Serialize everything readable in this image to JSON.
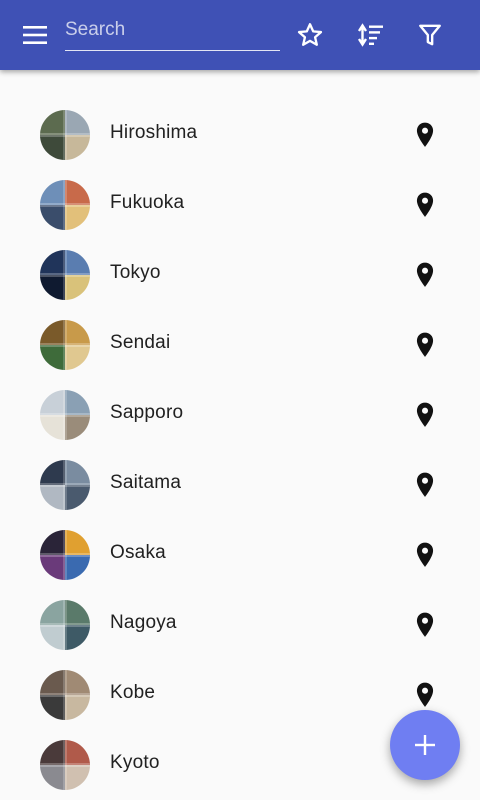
{
  "appbar": {
    "color": "#3f51b5",
    "menu_icon": "menu-icon",
    "search_placeholder": "Search",
    "search_value": "",
    "actions": [
      "star-icon",
      "sort-icon",
      "filter-icon"
    ]
  },
  "cities": [
    {
      "name": "Hiroshima"
    },
    {
      "name": "Fukuoka"
    },
    {
      "name": "Tokyo"
    },
    {
      "name": "Sendai"
    },
    {
      "name": "Sapporo"
    },
    {
      "name": "Saitama"
    },
    {
      "name": "Osaka"
    },
    {
      "name": "Nagoya"
    },
    {
      "name": "Kobe"
    },
    {
      "name": "Kyoto"
    }
  ],
  "row_icon": "map-pin-icon",
  "fab": {
    "icon": "add-icon",
    "color": "#6f7ef2"
  }
}
